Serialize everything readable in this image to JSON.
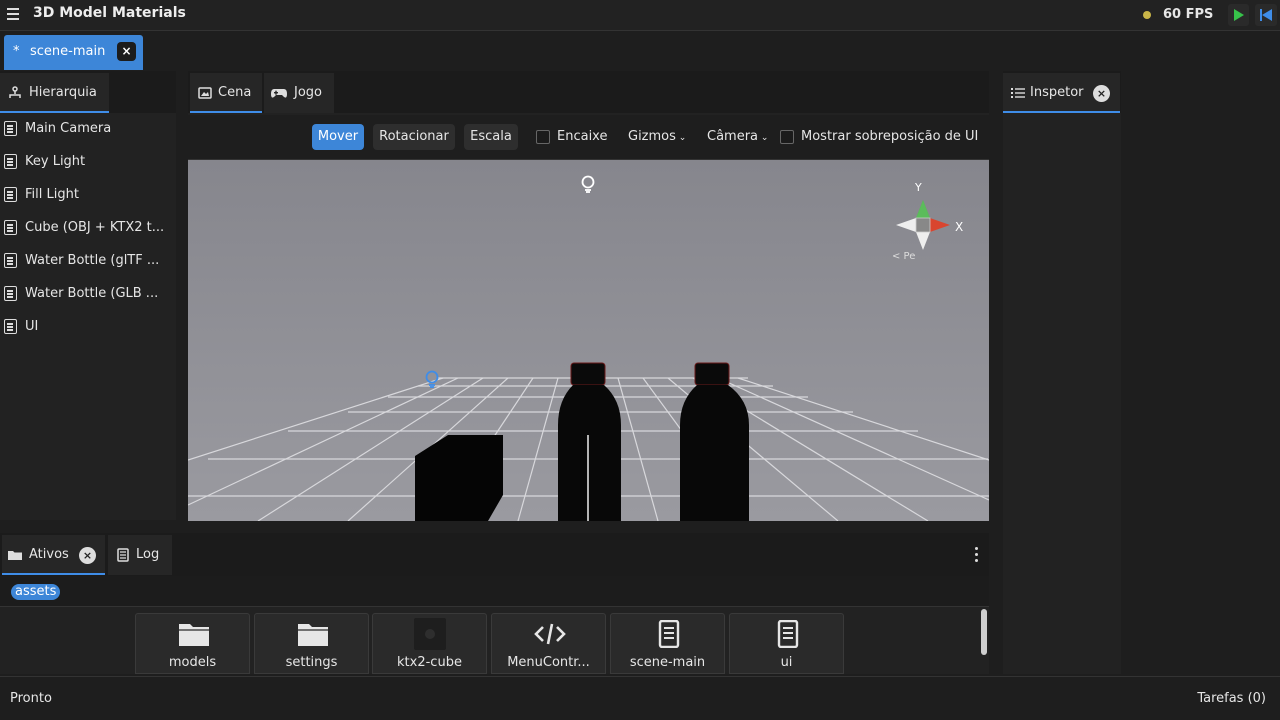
{
  "app": {
    "title": "3D Model Materials",
    "fps": "60 FPS"
  },
  "scene_tab": {
    "modified": "*",
    "label": "scene-main",
    "close": "×"
  },
  "hierarchy": {
    "tab_label": "Hierarquia",
    "items": [
      {
        "label": "Main Camera"
      },
      {
        "label": "Key Light"
      },
      {
        "label": "Fill Light"
      },
      {
        "label": "Cube (OBJ + KTX2 t..."
      },
      {
        "label": "Water Bottle (glTF ..."
      },
      {
        "label": "Water Bottle (GLB ..."
      },
      {
        "label": "UI"
      }
    ]
  },
  "view_tabs": {
    "scene": "Cena",
    "game": "Jogo"
  },
  "toolbar": {
    "move": "Mover",
    "rotate": "Rotacionar",
    "scale": "Escala",
    "snap": "Encaixe",
    "gizmos": "Gizmos",
    "camera": "Câmera",
    "show_ui_overlay": "Mostrar sobreposição de UI"
  },
  "axis_gizmo": {
    "y": "Y",
    "x": "X",
    "persp": "< Pe"
  },
  "inspector": {
    "tab_label": "Inspetor",
    "close": "×"
  },
  "bottom": {
    "assets_tab": "Ativos",
    "assets_close": "×",
    "log_tab": "Log",
    "path": "assets",
    "items": [
      {
        "label": "models",
        "icon": "folder-icon"
      },
      {
        "label": "settings",
        "icon": "folder-icon"
      },
      {
        "label": "ktx2-cube",
        "icon": "texture-thumbnail"
      },
      {
        "label": "MenuContr...",
        "icon": "code-icon"
      },
      {
        "label": "scene-main",
        "icon": "document-icon"
      },
      {
        "label": "ui",
        "icon": "document-icon"
      }
    ]
  },
  "status": {
    "left": "Pronto",
    "right": "Tarefas (0)"
  },
  "colors": {
    "accent": "#3d86d8",
    "play": "#37c24a",
    "fps_dot": "#c9b548"
  }
}
